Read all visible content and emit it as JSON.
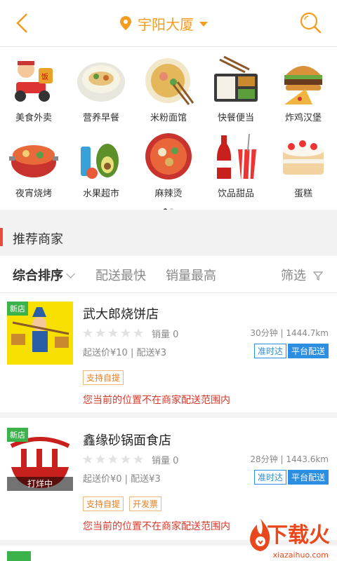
{
  "header": {
    "location": "宇阳大厦",
    "back_icon": "back-chevron-icon",
    "search_icon": "search-icon",
    "accent": "#f39c1f"
  },
  "categories": [
    {
      "label": "美食外卖",
      "icon": "food-delivery-icon"
    },
    {
      "label": "营养早餐",
      "icon": "breakfast-icon"
    },
    {
      "label": "米粉面馆",
      "icon": "noodle-bowl-icon"
    },
    {
      "label": "快餐便当",
      "icon": "bento-box-icon"
    },
    {
      "label": "炸鸡汉堡",
      "icon": "burger-icon"
    },
    {
      "label": "夜宵烧烤",
      "icon": "hotpot-icon"
    },
    {
      "label": "水果超市",
      "icon": "fruit-icon"
    },
    {
      "label": "麻辣烫",
      "icon": "spicy-soup-icon"
    },
    {
      "label": "饮品甜品",
      "icon": "drinks-icon"
    },
    {
      "label": "蛋糕",
      "icon": "cake-icon"
    }
  ],
  "pager": {
    "pages": 2,
    "current": 1
  },
  "section_title": "推荐商家",
  "sort": {
    "options": [
      "综合排序",
      "配送最快",
      "销量最高"
    ],
    "filter": "筛选"
  },
  "shops": [
    {
      "new_tag": "新店",
      "name": "武大郎烧饼店",
      "sales": "销量 0",
      "time_distance": "30分钟 | 1444.7km",
      "price": "起送价¥10 | 配送¥3",
      "badge1": "准时达",
      "badge2": "平台配送",
      "tags": [
        "支持自提"
      ],
      "warning": "您当前的位置不在商家配送范围内",
      "rating": 0
    },
    {
      "new_tag": "新店",
      "name": "鑫缘砂锅面食店",
      "sales": "销量 0",
      "time_distance": "28分钟 | 1443.6km",
      "price": "起送价¥0 | 配送¥3",
      "badge1": "准时达",
      "badge2": "平台配送",
      "tags": [
        "支持自提",
        "开发票"
      ],
      "warning": "您当前的位置不在商家配送范围内",
      "status": "打烊中",
      "rating": 0
    }
  ],
  "watermark": {
    "text": "下载火",
    "sub": "xiazaihuo.com"
  }
}
